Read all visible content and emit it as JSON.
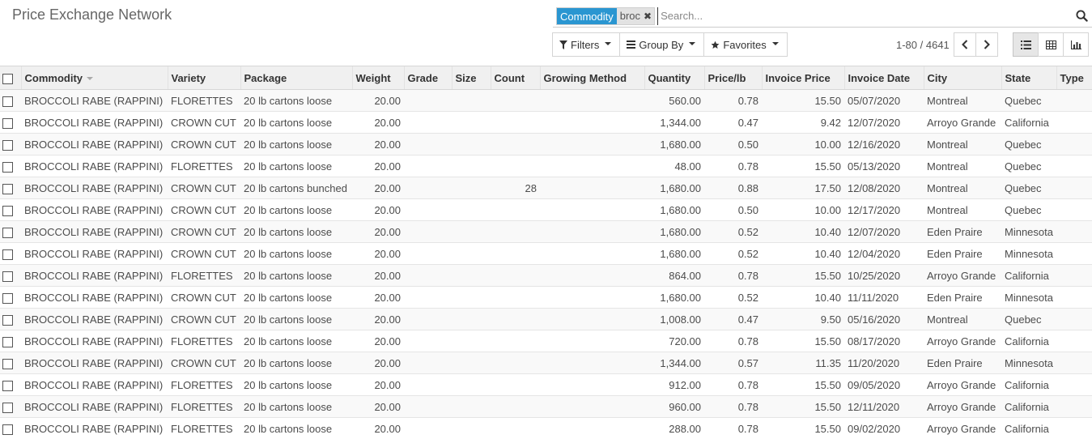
{
  "app": {
    "title": "Price Exchange Network"
  },
  "search": {
    "facet_category": "Commodity",
    "facet_value": "broc",
    "placeholder": "Search..."
  },
  "toolbar": {
    "filters_label": "Filters",
    "groupby_label": "Group By",
    "favorites_label": "Favorites"
  },
  "pager": {
    "value": "1-80 / 4641"
  },
  "colors": {
    "facet_accent": "#2a96d1"
  },
  "icons": [
    "search-icon",
    "filter-icon",
    "group-by-icon",
    "star-icon",
    "chevron-left-icon",
    "chevron-right-icon",
    "list-view-icon",
    "grid-view-icon",
    "graph-view-icon"
  ],
  "table": {
    "columns": [
      "Commodity",
      "Variety",
      "Package",
      "Weight",
      "Grade",
      "Size",
      "Count",
      "Growing Method",
      "Quantity",
      "Price/lb",
      "Invoice Price",
      "Invoice Date",
      "City",
      "State",
      "Type"
    ],
    "rows": [
      [
        "BROCCOLI RABE (RAPPINI)",
        "FLORETTES",
        "20 lb cartons loose",
        "20.00",
        "",
        "",
        "",
        "",
        "560.00",
        "0.78",
        "15.50",
        "05/07/2020",
        "Montreal",
        "Quebec",
        ""
      ],
      [
        "BROCCOLI RABE (RAPPINI)",
        "CROWN CUT",
        "20 lb cartons loose",
        "20.00",
        "",
        "",
        "",
        "",
        "1,344.00",
        "0.47",
        "9.42",
        "12/07/2020",
        "Arroyo Grande",
        "California",
        ""
      ],
      [
        "BROCCOLI RABE (RAPPINI)",
        "CROWN CUT",
        "20 lb cartons loose",
        "20.00",
        "",
        "",
        "",
        "",
        "1,680.00",
        "0.50",
        "10.00",
        "12/16/2020",
        "Montreal",
        "Quebec",
        ""
      ],
      [
        "BROCCOLI RABE (RAPPINI)",
        "FLORETTES",
        "20 lb cartons loose",
        "20.00",
        "",
        "",
        "",
        "",
        "48.00",
        "0.78",
        "15.50",
        "05/13/2020",
        "Montreal",
        "Quebec",
        ""
      ],
      [
        "BROCCOLI RABE (RAPPINI)",
        "CROWN CUT",
        "20 lb cartons bunched",
        "20.00",
        "",
        "",
        "28",
        "",
        "1,680.00",
        "0.88",
        "17.50",
        "12/08/2020",
        "Montreal",
        "Quebec",
        ""
      ],
      [
        "BROCCOLI RABE (RAPPINI)",
        "CROWN CUT",
        "20 lb cartons loose",
        "20.00",
        "",
        "",
        "",
        "",
        "1,680.00",
        "0.50",
        "10.00",
        "12/17/2020",
        "Montreal",
        "Quebec",
        ""
      ],
      [
        "BROCCOLI RABE (RAPPINI)",
        "CROWN CUT",
        "20 lb cartons loose",
        "20.00",
        "",
        "",
        "",
        "",
        "1,680.00",
        "0.52",
        "10.40",
        "12/07/2020",
        "Eden Praire",
        "Minnesota",
        ""
      ],
      [
        "BROCCOLI RABE (RAPPINI)",
        "CROWN CUT",
        "20 lb cartons loose",
        "20.00",
        "",
        "",
        "",
        "",
        "1,680.00",
        "0.52",
        "10.40",
        "12/04/2020",
        "Eden Praire",
        "Minnesota",
        ""
      ],
      [
        "BROCCOLI RABE (RAPPINI)",
        "FLORETTES",
        "20 lb cartons loose",
        "20.00",
        "",
        "",
        "",
        "",
        "864.00",
        "0.78",
        "15.50",
        "10/25/2020",
        "Arroyo Grande",
        "California",
        ""
      ],
      [
        "BROCCOLI RABE (RAPPINI)",
        "CROWN CUT",
        "20 lb cartons loose",
        "20.00",
        "",
        "",
        "",
        "",
        "1,680.00",
        "0.52",
        "10.40",
        "11/11/2020",
        "Eden Praire",
        "Minnesota",
        ""
      ],
      [
        "BROCCOLI RABE (RAPPINI)",
        "CROWN CUT",
        "20 lb cartons loose",
        "20.00",
        "",
        "",
        "",
        "",
        "1,008.00",
        "0.47",
        "9.50",
        "05/16/2020",
        "Montreal",
        "Quebec",
        ""
      ],
      [
        "BROCCOLI RABE (RAPPINI)",
        "FLORETTES",
        "20 lb cartons loose",
        "20.00",
        "",
        "",
        "",
        "",
        "720.00",
        "0.78",
        "15.50",
        "08/17/2020",
        "Arroyo Grande",
        "California",
        ""
      ],
      [
        "BROCCOLI RABE (RAPPINI)",
        "CROWN CUT",
        "20 lb cartons loose",
        "20.00",
        "",
        "",
        "",
        "",
        "1,344.00",
        "0.57",
        "11.35",
        "11/20/2020",
        "Eden Praire",
        "Minnesota",
        ""
      ],
      [
        "BROCCOLI RABE (RAPPINI)",
        "FLORETTES",
        "20 lb cartons loose",
        "20.00",
        "",
        "",
        "",
        "",
        "912.00",
        "0.78",
        "15.50",
        "09/05/2020",
        "Arroyo Grande",
        "California",
        ""
      ],
      [
        "BROCCOLI RABE (RAPPINI)",
        "FLORETTES",
        "20 lb cartons loose",
        "20.00",
        "",
        "",
        "",
        "",
        "960.00",
        "0.78",
        "15.50",
        "12/11/2020",
        "Arroyo Grande",
        "California",
        ""
      ],
      [
        "BROCCOLI RABE (RAPPINI)",
        "FLORETTES",
        "20 lb cartons loose",
        "20.00",
        "",
        "",
        "",
        "",
        "288.00",
        "0.78",
        "15.50",
        "09/02/2020",
        "Arroyo Grande",
        "California",
        ""
      ]
    ]
  }
}
